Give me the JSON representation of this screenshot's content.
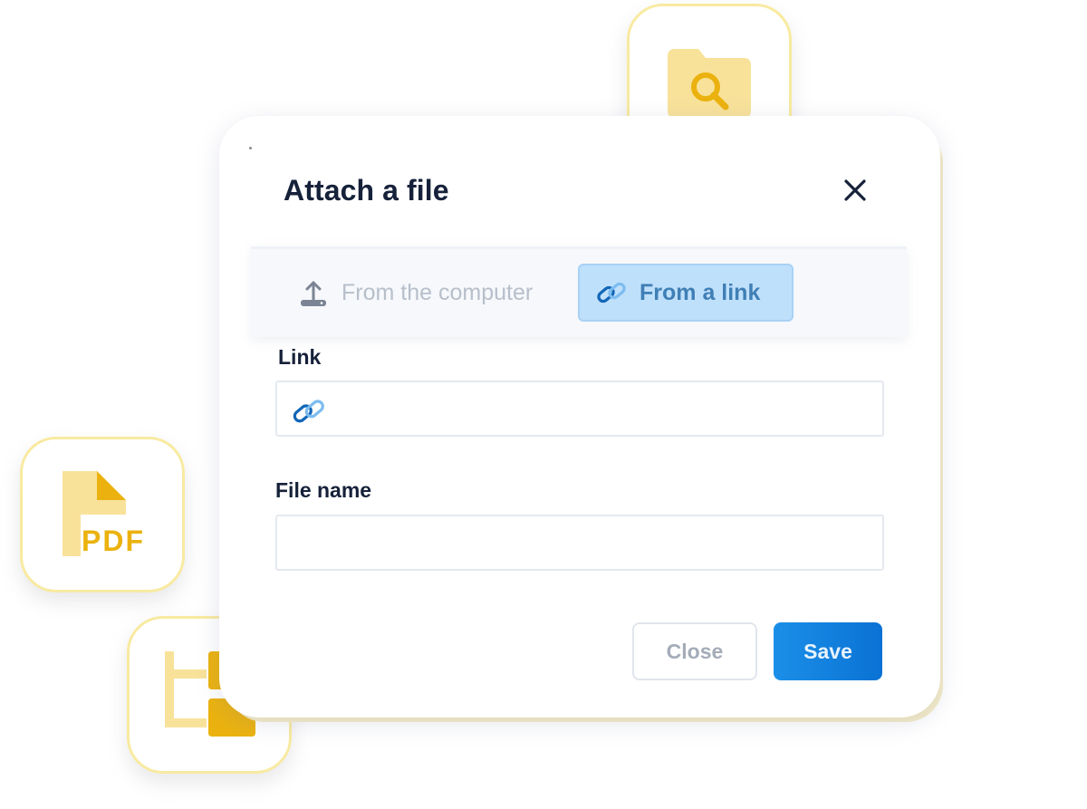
{
  "dialog": {
    "title": "Attach a file",
    "close_icon": "close-icon"
  },
  "tabs": [
    {
      "label": "From the computer",
      "icon": "upload-icon",
      "selected": false
    },
    {
      "label": "From a link",
      "icon": "link-icon",
      "selected": true
    }
  ],
  "fields": {
    "link": {
      "label": "Link",
      "value": "",
      "placeholder": "",
      "icon": "link-icon"
    },
    "file_name": {
      "label": "File name",
      "value": "",
      "placeholder": ""
    }
  },
  "buttons": {
    "close_label": "Close",
    "save_label": "Save"
  },
  "decorations": {
    "pdf_text": "PDF",
    "icons": [
      "folder-search-icon",
      "pdf-file-icon",
      "folder-tree-icon"
    ]
  },
  "colors": {
    "accent": "#1b8fe8",
    "tab_selected_bg": "#bfe0fb",
    "badge_border": "#f8eaa0",
    "folder_light": "#f8e29a",
    "folder_dark": "#ebb20f"
  }
}
